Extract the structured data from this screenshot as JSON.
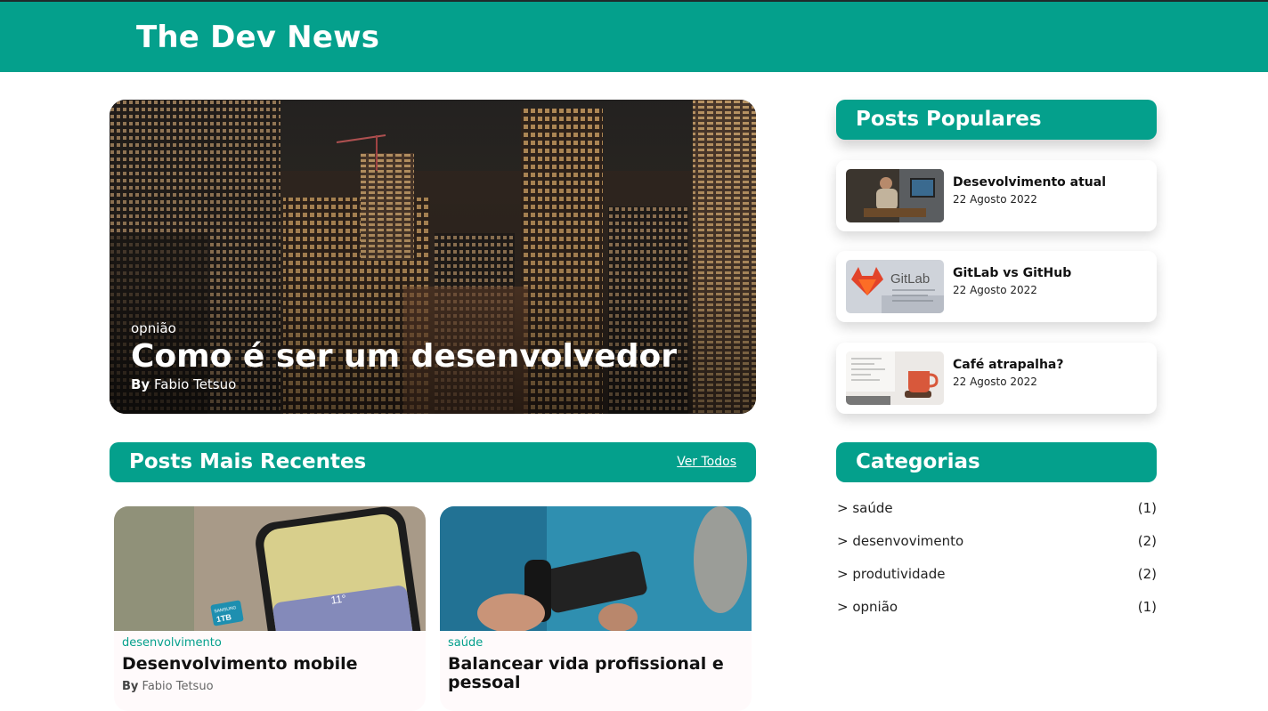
{
  "header": {
    "brand": "The Dev News"
  },
  "hero": {
    "category": "opnião",
    "title": "Como é ser um desenvolvedor",
    "author_prefix": "By",
    "author_name": "Fabio Tetsuo"
  },
  "recent": {
    "title": "Posts Mais Recentes",
    "see_all": "Ver Todos",
    "posts": [
      {
        "category": "desenvolvimento",
        "title": "Desenvolvimento mobile",
        "author_prefix": "By",
        "author_name": "Fabio Tetsuo"
      },
      {
        "category": "saúde",
        "title": "Balancear vida profissional e pessoal"
      }
    ]
  },
  "popular": {
    "title": "Posts Populares",
    "posts": [
      {
        "title": "Desevolvimento atual",
        "date": "22 Agosto 2022"
      },
      {
        "title": "GitLab vs GitHub",
        "date": "22 Agosto 2022"
      },
      {
        "title": "Café atrapalha?",
        "date": "22 Agosto 2022"
      }
    ]
  },
  "categories": {
    "title": "Categorias",
    "items": [
      {
        "name": "> saúde",
        "count": "(1)"
      },
      {
        "name": "> desenvovimento",
        "count": "(2)"
      },
      {
        "name": "> produtividade",
        "count": "(2)"
      },
      {
        "name": "> opnião",
        "count": "(1)"
      }
    ]
  },
  "thumb_text": {
    "gitlab": "GitLab",
    "phone_temp": "11°",
    "sd_brand": "SAMSUNG",
    "sd_size": "1TB"
  },
  "colors": {
    "accent": "#04a08c",
    "text": "#111111"
  }
}
